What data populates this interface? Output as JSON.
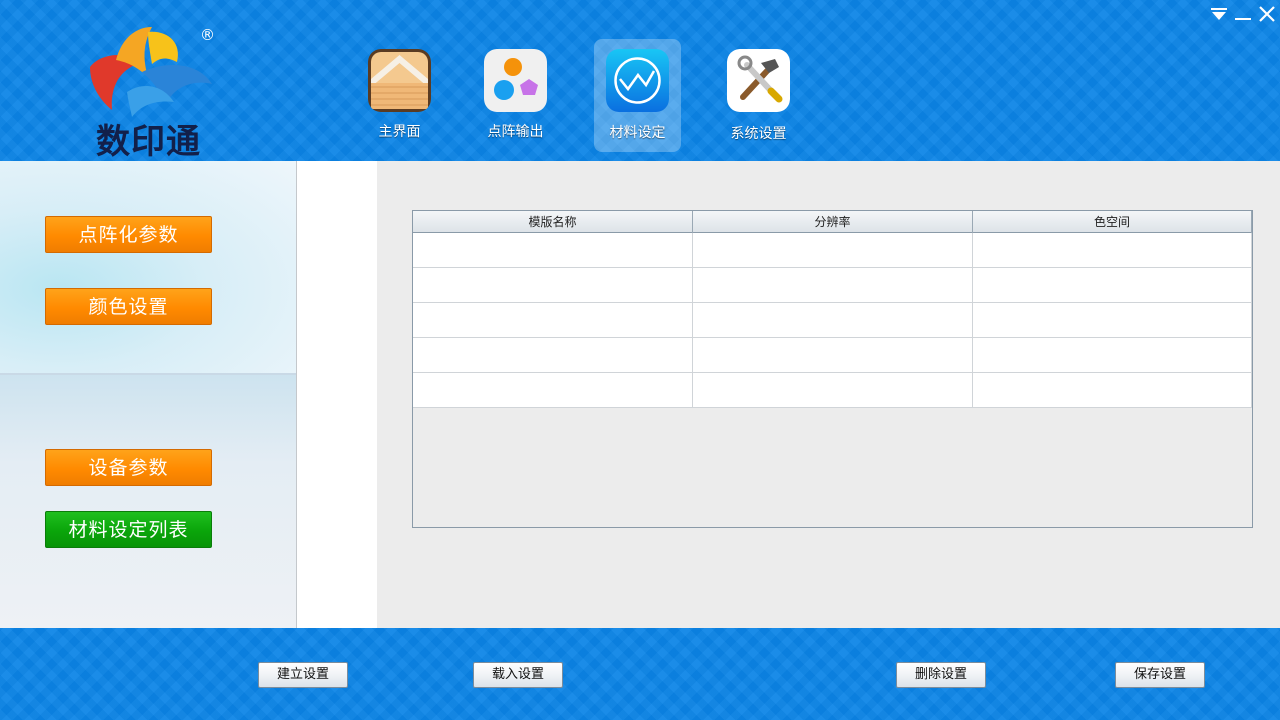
{
  "brand": {
    "name": "数印通",
    "registered_mark": "®"
  },
  "window_controls": {
    "menu_icon": "dropdown-triangle-icon",
    "minimize_icon": "minimize-icon",
    "close_icon": "close-icon"
  },
  "nav": {
    "items": [
      {
        "label": "主界面",
        "icon": "home-icon"
      },
      {
        "label": "点阵输出",
        "icon": "dots-icon"
      },
      {
        "label": "材料设定",
        "icon": "chart-icon",
        "active": true
      },
      {
        "label": "系统设置",
        "icon": "tools-icon"
      }
    ]
  },
  "sidebar": {
    "buttons": [
      {
        "label": "点阵化参数"
      },
      {
        "label": "颜色设置"
      },
      {
        "label": "设备参数"
      },
      {
        "label": "材料设定列表"
      }
    ]
  },
  "table": {
    "columns": [
      "模版名称",
      "分辨率",
      "色空间"
    ],
    "rows": [
      [
        "",
        "",
        ""
      ],
      [
        "",
        "",
        ""
      ],
      [
        "",
        "",
        ""
      ],
      [
        "",
        "",
        ""
      ],
      [
        "",
        "",
        ""
      ]
    ]
  },
  "footer": {
    "create_label": "建立设置",
    "load_label": "载入设置",
    "delete_label": "删除设置",
    "save_label": "保存设置"
  },
  "colors": {
    "header_blue": "#0b84e6",
    "orange_button": "#ff8a00",
    "green_button": "#0aa50a"
  }
}
